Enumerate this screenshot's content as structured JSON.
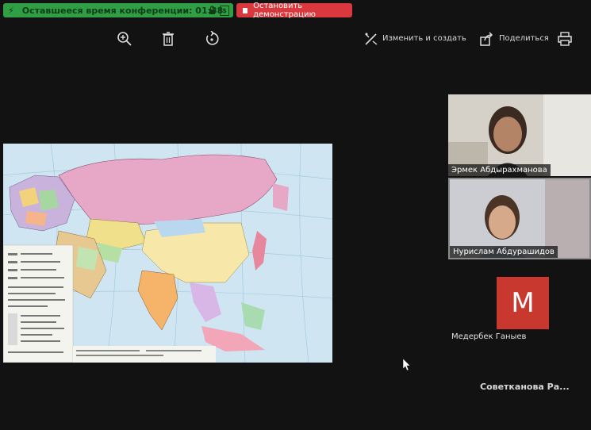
{
  "meeting": {
    "timer_text": "Оставшееся время конференции: 01:38",
    "stop_label": "Остановить демонстрацию"
  },
  "toolbar": {
    "zoom_icon": "zoom-in-icon",
    "delete_icon": "trash-icon",
    "rotate_icon": "rotate-icon",
    "edit_label": "Изменить и создать",
    "share_label": "Поделиться",
    "print_icon": "printer-icon"
  },
  "participants": [
    {
      "name": "Эрмек Абдырахманова"
    },
    {
      "name": "Нурислам Абдурашидов"
    },
    {
      "name": "Медербек Ганыев",
      "initial": "М"
    },
    {
      "name": "Советканова  Ра..."
    }
  ],
  "colors": {
    "timer_green": "#2f9e45",
    "stop_red": "#d9383e",
    "avatar_red": "#c8382f",
    "background": "#121212"
  }
}
